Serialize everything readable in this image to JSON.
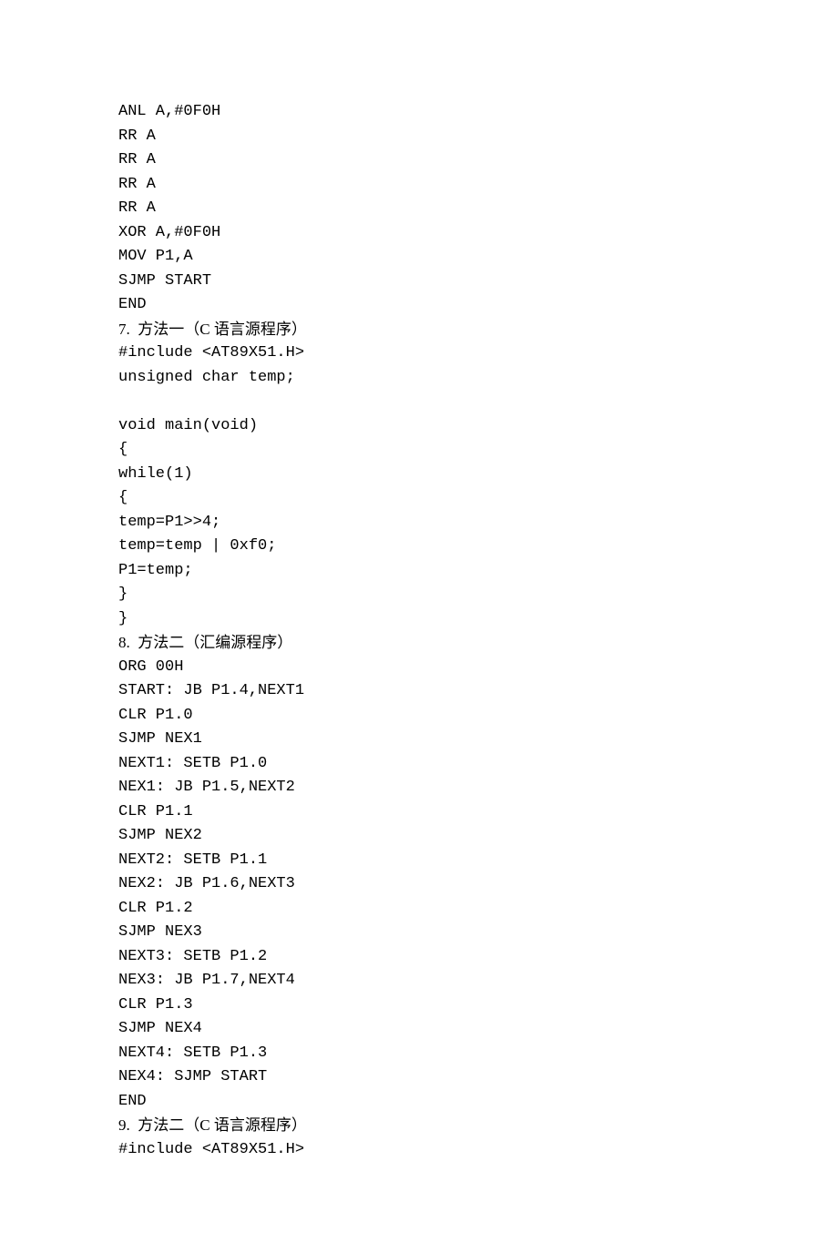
{
  "lines": [
    {
      "type": "code",
      "text": "ANL A,#0F0H"
    },
    {
      "type": "code",
      "text": "RR A"
    },
    {
      "type": "code",
      "text": "RR A"
    },
    {
      "type": "code",
      "text": "RR A"
    },
    {
      "type": "code",
      "text": "RR A"
    },
    {
      "type": "code",
      "text": "XOR A,#0F0H"
    },
    {
      "type": "code",
      "text": "MOV P1,A"
    },
    {
      "type": "code",
      "text": "SJMP START"
    },
    {
      "type": "code",
      "text": "END"
    },
    {
      "type": "heading",
      "text": "7.  方法一（C 语言源程序）"
    },
    {
      "type": "code",
      "text": "#include <AT89X51.H>"
    },
    {
      "type": "code",
      "text": "unsigned char temp;"
    },
    {
      "type": "blank",
      "text": ""
    },
    {
      "type": "code",
      "text": "void main(void)"
    },
    {
      "type": "code",
      "text": "{"
    },
    {
      "type": "code",
      "text": "while(1)"
    },
    {
      "type": "code",
      "text": "{"
    },
    {
      "type": "code",
      "text": "temp=P1>>4;"
    },
    {
      "type": "code",
      "text": "temp=temp | 0xf0;"
    },
    {
      "type": "code",
      "text": "P1=temp;"
    },
    {
      "type": "code",
      "text": "}"
    },
    {
      "type": "code",
      "text": "}"
    },
    {
      "type": "heading",
      "text": "8.  方法二（汇编源程序）"
    },
    {
      "type": "code",
      "text": "ORG 00H"
    },
    {
      "type": "code",
      "text": "START: JB P1.4,NEXT1"
    },
    {
      "type": "code",
      "text": "CLR P1.0"
    },
    {
      "type": "code",
      "text": "SJMP NEX1"
    },
    {
      "type": "code",
      "text": "NEXT1: SETB P1.0"
    },
    {
      "type": "code",
      "text": "NEX1: JB P1.5,NEXT2"
    },
    {
      "type": "code",
      "text": "CLR P1.1"
    },
    {
      "type": "code",
      "text": "SJMP NEX2"
    },
    {
      "type": "code",
      "text": "NEXT2: SETB P1.1"
    },
    {
      "type": "code",
      "text": "NEX2: JB P1.6,NEXT3"
    },
    {
      "type": "code",
      "text": "CLR P1.2"
    },
    {
      "type": "code",
      "text": "SJMP NEX3"
    },
    {
      "type": "code",
      "text": "NEXT3: SETB P1.2"
    },
    {
      "type": "code",
      "text": "NEX3: JB P1.7,NEXT4"
    },
    {
      "type": "code",
      "text": "CLR P1.3"
    },
    {
      "type": "code",
      "text": "SJMP NEX4"
    },
    {
      "type": "code",
      "text": "NEXT4: SETB P1.3"
    },
    {
      "type": "code",
      "text": "NEX4: SJMP START"
    },
    {
      "type": "code",
      "text": "END"
    },
    {
      "type": "heading",
      "text": "9.  方法二（C 语言源程序）"
    },
    {
      "type": "code",
      "text": "#include <AT89X51.H>"
    }
  ]
}
